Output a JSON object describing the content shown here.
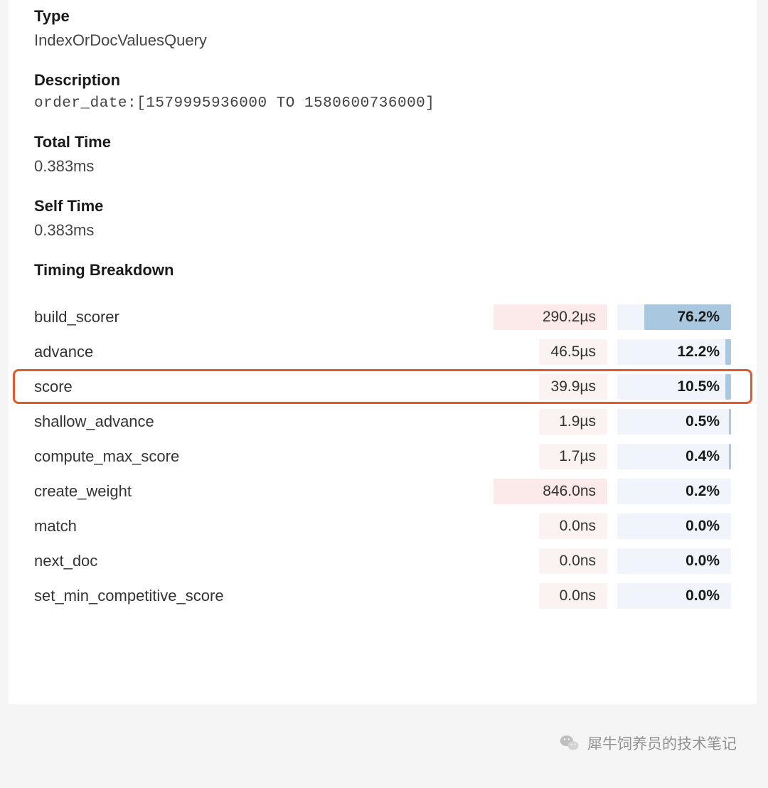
{
  "sections": {
    "type": {
      "label": "Type",
      "value": "IndexOrDocValuesQuery"
    },
    "description": {
      "label": "Description",
      "value": "order_date:[1579995936000 TO 1580600736000]"
    },
    "total_time": {
      "label": "Total Time",
      "value": "0.383ms"
    },
    "self_time": {
      "label": "Self Time",
      "value": "0.383ms"
    }
  },
  "breakdown": {
    "header": "Timing Breakdown",
    "rows": [
      {
        "label": "build_scorer",
        "time": "290.2µs",
        "pct": "76.2%",
        "time_bar": 100,
        "pct_bar": 76.2,
        "faint": false,
        "highlight": false
      },
      {
        "label": "advance",
        "time": "46.5µs",
        "pct": "12.2%",
        "time_bar": 60,
        "pct_bar": 5,
        "faint": true,
        "highlight": false
      },
      {
        "label": "score",
        "time": "39.9µs",
        "pct": "10.5%",
        "time_bar": 60,
        "pct_bar": 5,
        "faint": true,
        "highlight": true
      },
      {
        "label": "shallow_advance",
        "time": "1.9µs",
        "pct": "0.5%",
        "time_bar": 60,
        "pct_bar": 2,
        "faint": true,
        "highlight": false
      },
      {
        "label": "compute_max_score",
        "time": "1.7µs",
        "pct": "0.4%",
        "time_bar": 60,
        "pct_bar": 2,
        "faint": true,
        "highlight": false
      },
      {
        "label": "create_weight",
        "time": "846.0ns",
        "pct": "0.2%",
        "time_bar": 100,
        "pct_bar": 0,
        "faint": false,
        "highlight": false
      },
      {
        "label": "match",
        "time": "0.0ns",
        "pct": "0.0%",
        "time_bar": 60,
        "pct_bar": 0,
        "faint": true,
        "highlight": false
      },
      {
        "label": "next_doc",
        "time": "0.0ns",
        "pct": "0.0%",
        "time_bar": 60,
        "pct_bar": 0,
        "faint": true,
        "highlight": false
      },
      {
        "label": "set_min_competitive_score",
        "time": "0.0ns",
        "pct": "0.0%",
        "time_bar": 60,
        "pct_bar": 0,
        "faint": true,
        "highlight": false
      }
    ]
  },
  "watermark": "犀牛饲养员的技术笔记"
}
